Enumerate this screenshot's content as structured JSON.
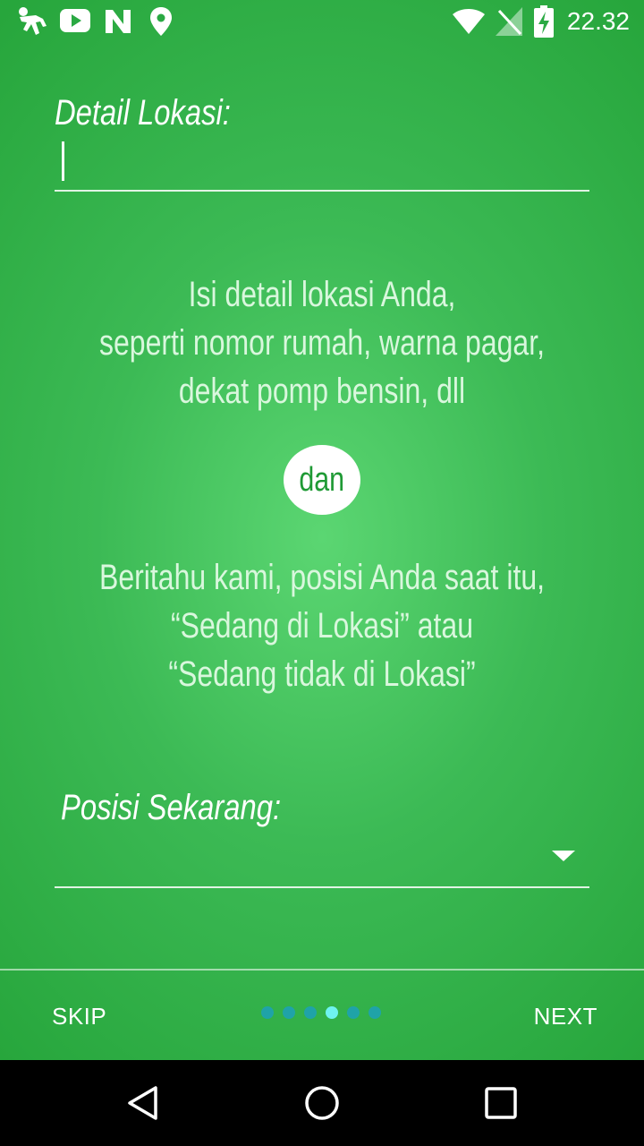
{
  "status_bar": {
    "time": "22.32",
    "left_icons": [
      "runner-app-icon",
      "youtube-icon",
      "n-app-icon",
      "location-pin-icon"
    ],
    "right_icons": [
      "wifi-icon",
      "no-signal-icon",
      "battery-charging-icon"
    ]
  },
  "detail_field": {
    "label": "Detail Lokasi:",
    "value": ""
  },
  "info_top": [
    "Isi detail lokasi Anda,",
    "seperti nomor rumah, warna pagar,",
    "dekat pomp bensin, dll"
  ],
  "connector": "dan",
  "info_bottom": [
    "Beritahu kami, posisi Anda saat itu,",
    "“Sedang di Lokasi” atau",
    "“Sedang tidak di Lokasi”"
  ],
  "posisi_field": {
    "label": "Posisi Sekarang:",
    "selected": ""
  },
  "footer": {
    "skip_label": "SKIP",
    "next_label": "NEXT",
    "page_count": 6,
    "current_page": 4
  },
  "colors": {
    "background_center": "#5bd672",
    "background_edge": "#27a63c",
    "dot_inactive": "#1fa3a8",
    "dot_active": "#6ff3f0",
    "badge_text": "#1f9a35"
  }
}
